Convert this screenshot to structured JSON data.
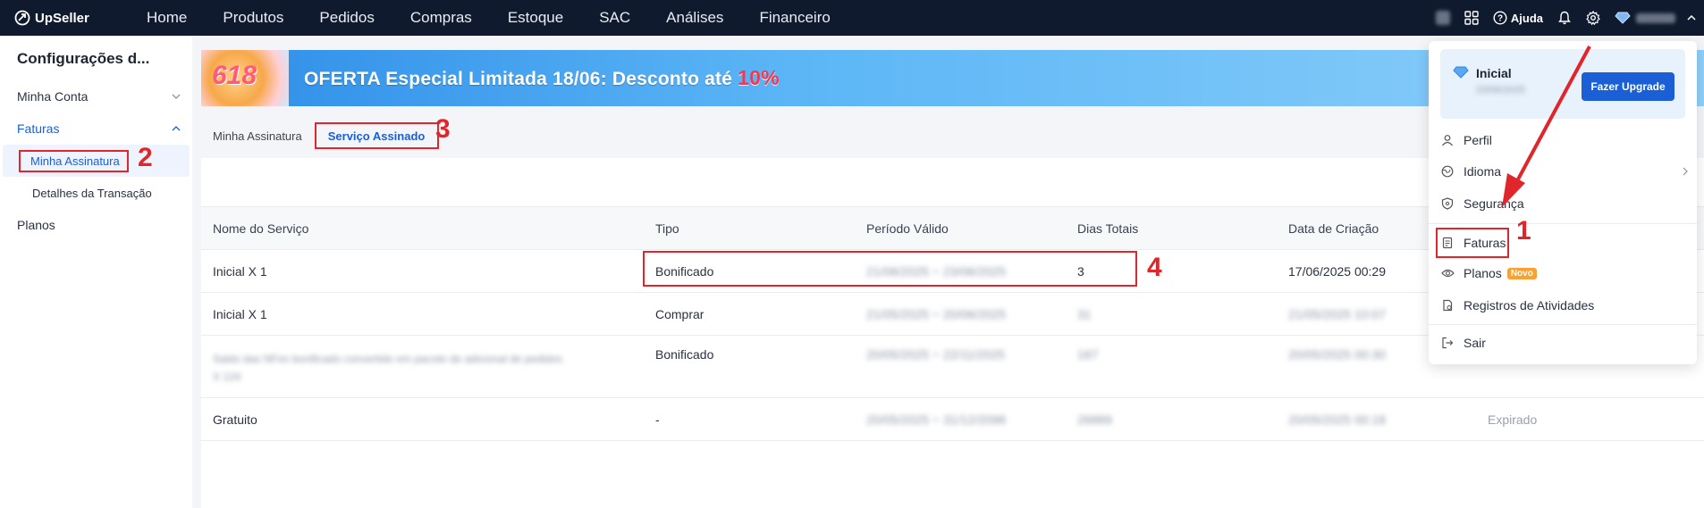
{
  "app": {
    "logo_text": "UpSeller"
  },
  "nav": {
    "items": [
      "Home",
      "Produtos",
      "Pedidos",
      "Compras",
      "Estoque",
      "SAC",
      "Análises",
      "Financeiro"
    ],
    "help_label": "Ajuda"
  },
  "sidebar": {
    "title": "Configurações d...",
    "minha_conta": "Minha Conta",
    "faturas": "Faturas",
    "minha_assinatura": "Minha Assinatura",
    "detalhes_transacao": "Detalhes da Transação",
    "planos": "Planos"
  },
  "banner": {
    "art_text": "618",
    "text": "OFERTA Especial Limitada 18/06: Desconto até ",
    "highlight": "10%"
  },
  "tabs": {
    "minha_assinatura": "Minha Assinatura",
    "servico_assinado": "Serviço Assinado"
  },
  "table": {
    "headers": [
      "Nome do Serviço",
      "Tipo",
      "Período Válido",
      "Dias Totais",
      "Data de Criação"
    ],
    "rows": [
      {
        "nome": "Inicial X 1",
        "tipo": "Bonificado",
        "periodo": "21/06/2025 ~ 23/06/2025",
        "dias": "3",
        "criacao": "17/06/2025 00:29",
        "status": ""
      },
      {
        "nome": "Inicial X 1",
        "tipo": "Comprar",
        "periodo": "21/05/2025 ~ 20/06/2025",
        "dias": "31",
        "criacao": "21/05/2025 10:07",
        "status": ""
      },
      {
        "nome": "Saldo das NFes bonificado convertido em pacote de adicional de pedidos",
        "nome2": "X 124",
        "tipo": "Bonificado",
        "periodo": "20/05/2025 ~ 22/11/2025",
        "dias": "187",
        "criacao": "20/05/2025 00:30",
        "status": ""
      },
      {
        "nome": "Gratuito",
        "tipo": "-",
        "periodo": "20/05/2025 ~ 31/12/2098",
        "dias": "26889",
        "criacao": "20/05/2025 00:18",
        "status": "Expirado"
      }
    ]
  },
  "dropdown": {
    "plan_name": "Inicial",
    "plan_date": "23/06/2025",
    "upgrade_label": "Fazer Upgrade",
    "perfil": "Perfil",
    "idioma": "Idioma",
    "seguranca": "Segurança",
    "faturas": "Faturas",
    "planos": "Planos",
    "novo_badge": "Novo",
    "registros": "Registros de Atividades",
    "sair": "Sair"
  },
  "annotations": {
    "a1": "1",
    "a2": "2",
    "a3": "3",
    "a4": "4"
  },
  "colors": {
    "nav_bg": "#0f1a2e",
    "accent": "#1b5fd6",
    "annotation": "#e0262a",
    "badge": "#f7a233"
  }
}
